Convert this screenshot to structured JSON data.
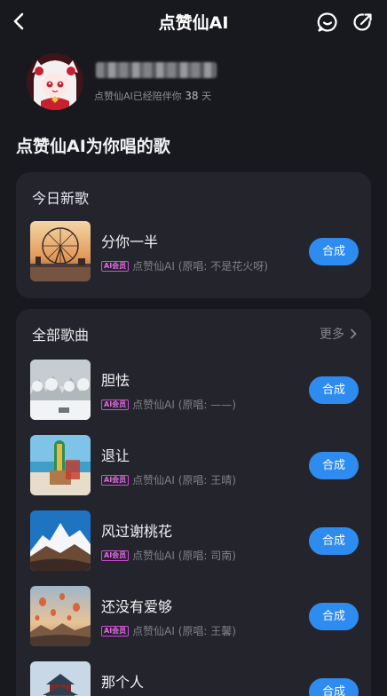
{
  "header": {
    "title": "点赞仙AI"
  },
  "profile": {
    "companion_prefix": "点赞仙AI已经陪伴你",
    "companion_days": "38",
    "companion_suffix": "天"
  },
  "section_title": "点赞仙AI为你唱的歌",
  "today": {
    "label": "今日新歌",
    "song": {
      "title": "分你一半",
      "badge": "AI会员",
      "artist": "点赞仙AI (原唱: 不是花火呀)",
      "button": "合成"
    }
  },
  "all": {
    "label": "全部歌曲",
    "more": "更多",
    "songs": [
      {
        "title": "胆怯",
        "badge": "AI会员",
        "artist": "点赞仙AI (原唱: ——)",
        "button": "合成"
      },
      {
        "title": "退让",
        "badge": "AI会员",
        "artist": "点赞仙AI (原唱: 王晴)",
        "button": "合成"
      },
      {
        "title": "风过谢桃花",
        "badge": "AI会员",
        "artist": "点赞仙AI (原唱: 司南)",
        "button": "合成"
      },
      {
        "title": "还没有爱够",
        "badge": "AI会员",
        "artist": "点赞仙AI (原唱: 王馨)",
        "button": "合成"
      },
      {
        "title": "那个人",
        "button": "合成"
      }
    ]
  },
  "icons": {
    "back": "chevron-left-icon",
    "chat": "chat-bubble-icon",
    "share": "share-icon",
    "more": "chevron-right-icon"
  },
  "colors": {
    "background": "#18191e",
    "card": "#24252c",
    "accent": "#2e8cf0",
    "badge": "#e06be0"
  }
}
